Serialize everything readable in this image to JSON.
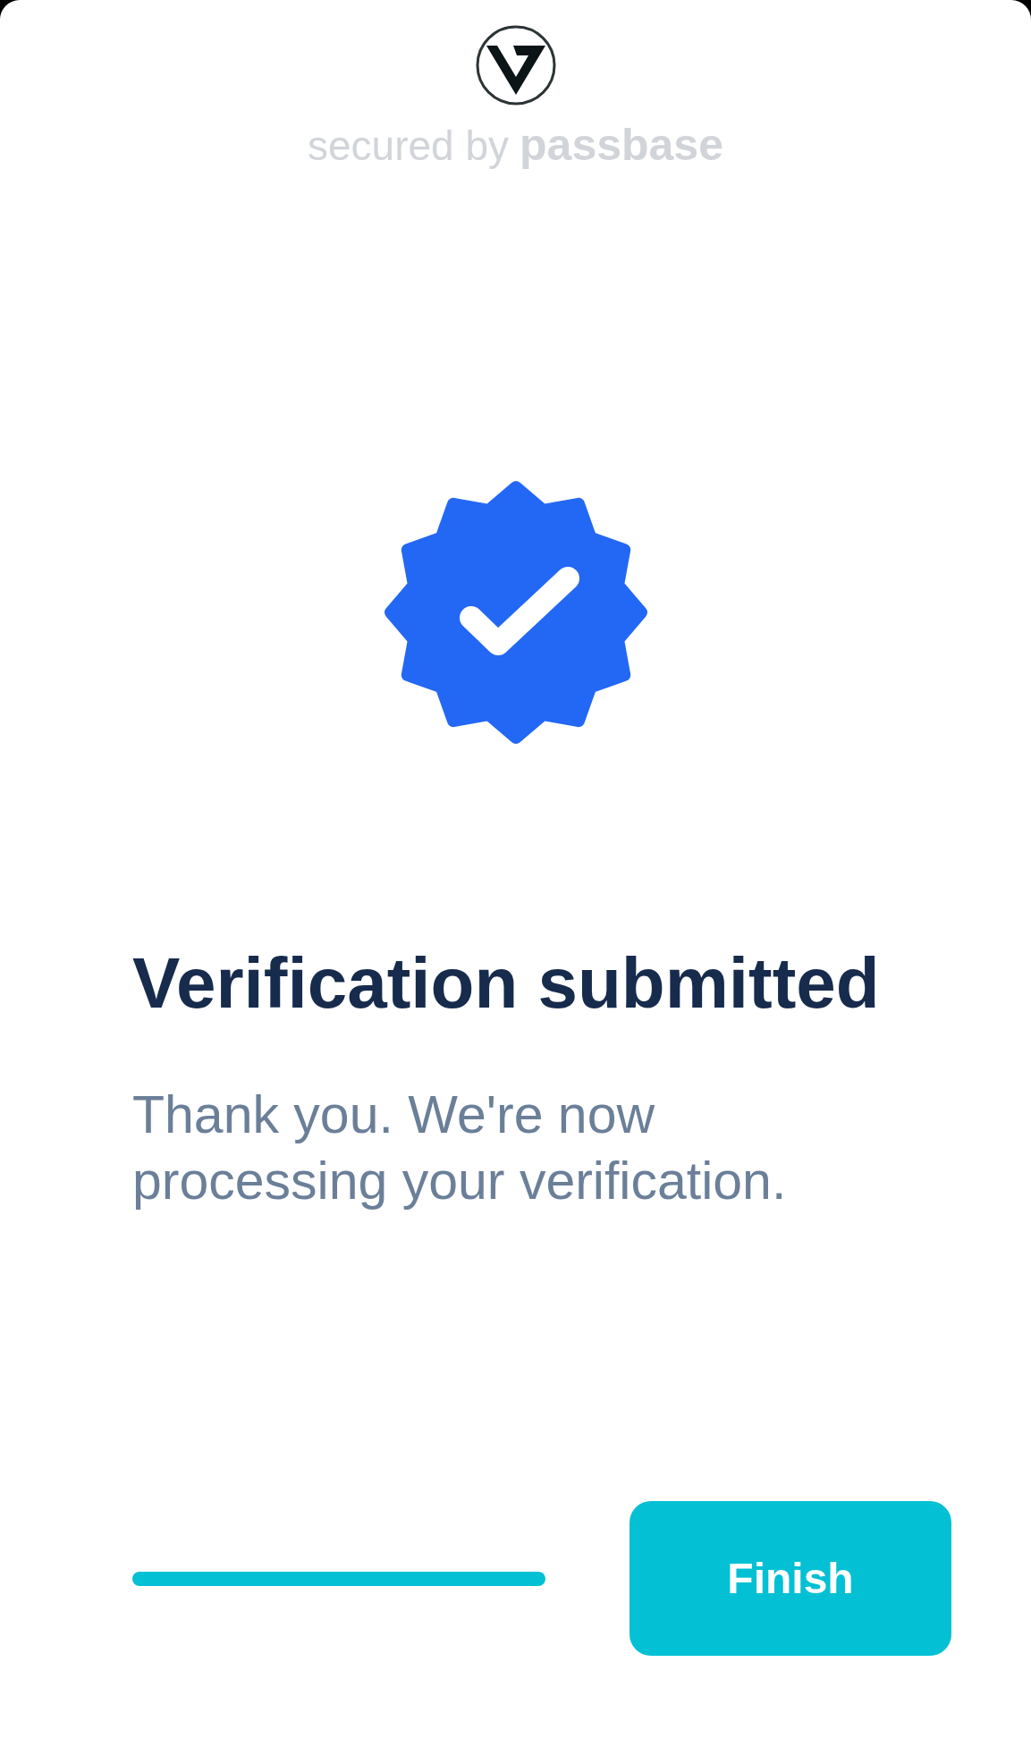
{
  "header": {
    "secured_by": "secured by",
    "brand": "passbase"
  },
  "title": "Verification submitted",
  "message": "Thank you. We're now processing your verification.",
  "buttons": [
    {
      "label": "Finish"
    }
  ]
}
